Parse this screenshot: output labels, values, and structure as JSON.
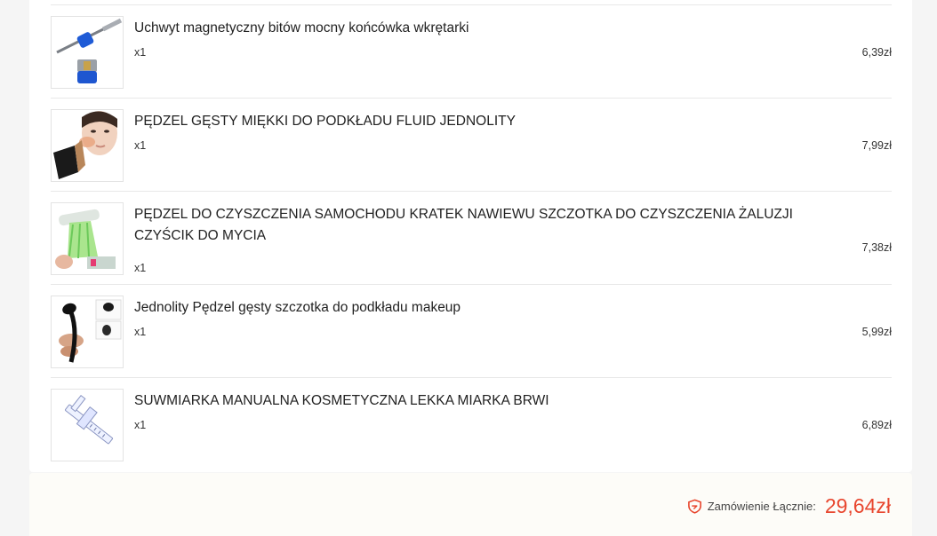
{
  "items": [
    {
      "title": "Uchwyt magnetyczny bitów mocny końcówka wkrętarki",
      "qty": "x1",
      "price": "6,39zł",
      "image_icon": "magnetic-bit-holder-icon"
    },
    {
      "title": "PĘDZEL GĘSTY MIĘKKI DO PODKŁADU FLUID JEDNOLITY",
      "qty": "x1",
      "price": "7,99zł",
      "image_icon": "makeup-brush-face-icon"
    },
    {
      "title": "PĘDZEL DO CZYSZCZENIA SAMOCHODU KRATEK NAWIEWU SZCZOTKA DO CZYSZCZENIA ŻALUZJI CZYŚCIK DO MYCIA",
      "qty": "x1",
      "price": "7,38zł",
      "image_icon": "cleaning-brush-icon"
    },
    {
      "title": "Jednolity Pędzel gęsty szczotka do podkładu makeup",
      "qty": "x1",
      "price": "5,99zł",
      "image_icon": "oval-brush-icon"
    },
    {
      "title": "SUWMIARKA MANUALNA KOSMETYCZNA LEKKA MIARKA BRWI",
      "qty": "x1",
      "price": "6,89zł",
      "image_icon": "caliper-icon"
    }
  ],
  "summary": {
    "label": "Zamówienie Łącznie:",
    "total": "29,64zł",
    "icon": "shield-icon",
    "accent_color": "#e8462e"
  }
}
